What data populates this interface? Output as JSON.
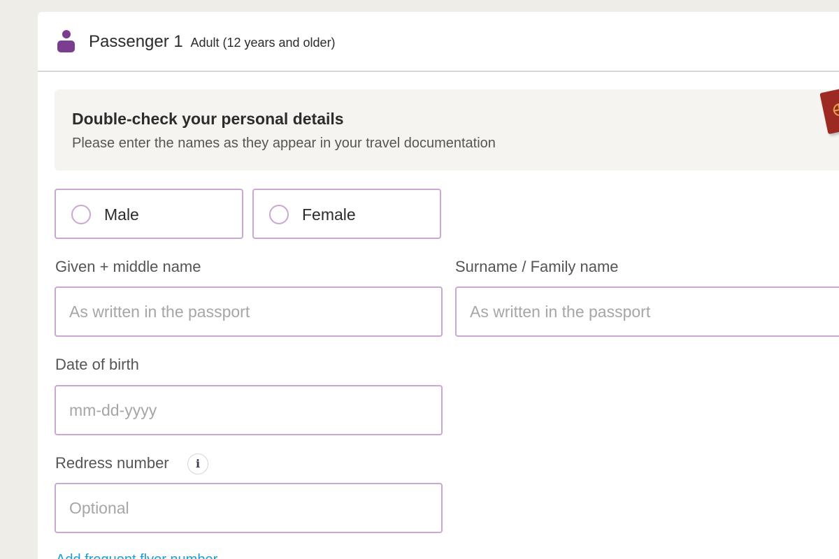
{
  "passenger": {
    "title": "Passenger 1",
    "subtitle": "Adult (12 years and older)",
    "icon": "person-icon",
    "icon_color": "#7a3d8f"
  },
  "notice": {
    "title": "Double-check your personal details",
    "text": "Please enter the names as they appear in your travel documentation",
    "icon": "passport-icon"
  },
  "gender": {
    "options": [
      "Male",
      "Female"
    ],
    "selected": null
  },
  "fields": {
    "given_name": {
      "label": "Given + middle name",
      "placeholder": "As written in the passport",
      "value": ""
    },
    "surname": {
      "label": "Surname / Family name",
      "placeholder": "As written in the passport",
      "value": ""
    },
    "dob": {
      "label": "Date of birth",
      "placeholder": "mm-dd-yyyy",
      "value": ""
    },
    "redress": {
      "label": "Redress number",
      "placeholder": "Optional",
      "value": "",
      "info_icon": "info-icon"
    }
  },
  "link": {
    "label": "Add frequent flyer number"
  },
  "colors": {
    "page_bg": "#efede7",
    "accent_border": "#c9a8d2",
    "link": "#1a9fd8"
  }
}
